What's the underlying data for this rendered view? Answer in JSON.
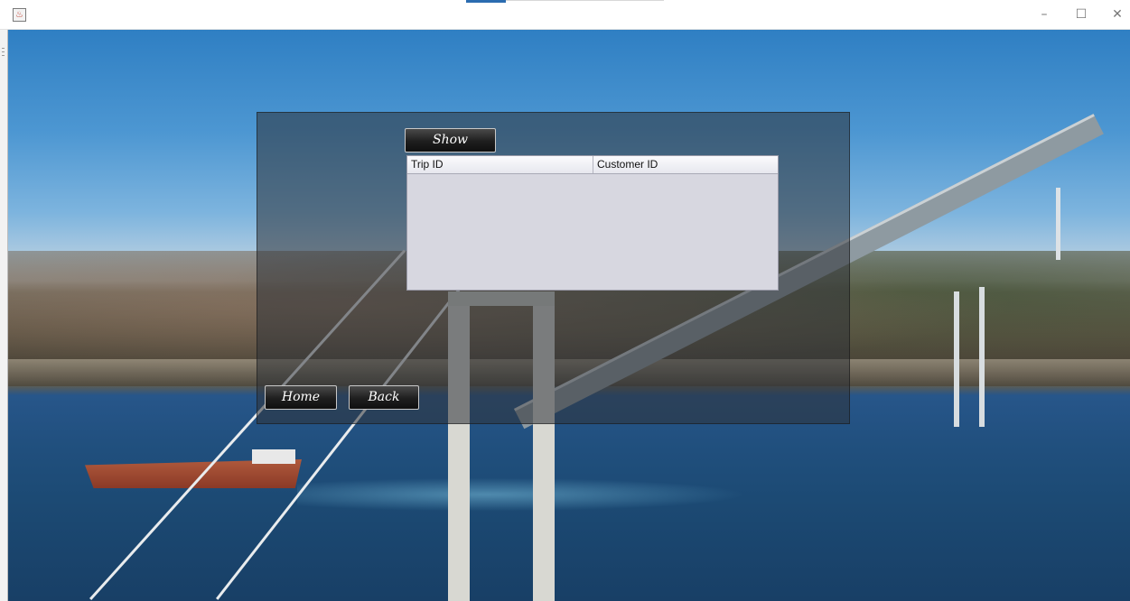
{
  "window": {
    "app_icon": "java-icon",
    "controls": {
      "minimize": "–",
      "maximize": "☐",
      "close": "✕"
    }
  },
  "panel": {
    "show_button": "Show",
    "home_button": "Home",
    "back_button": "Back",
    "table": {
      "columns": [
        "Trip ID",
        "Customer ID"
      ],
      "rows": []
    }
  },
  "colors": {
    "panel_overlay": "#2d3237",
    "button_bg": "#1e1e1e",
    "table_bg": "#d7d7e0"
  }
}
